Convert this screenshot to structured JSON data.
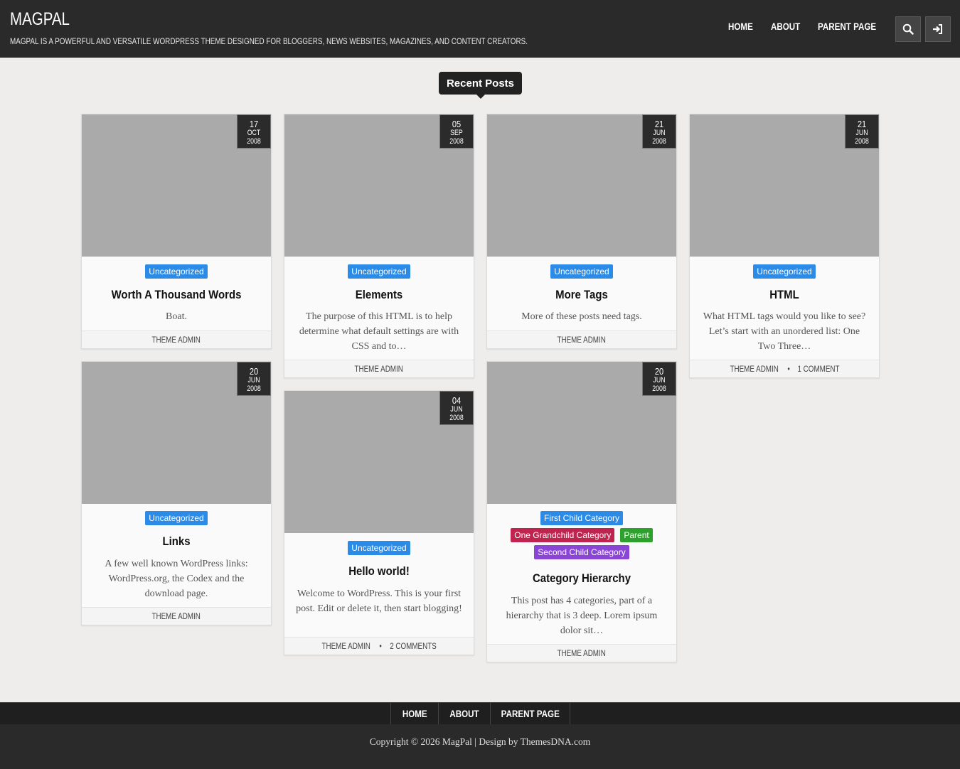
{
  "header": {
    "site_title": "MAGPAL",
    "site_description": "MAGPAL IS A POWERFUL AND VERSATILE WORDPRESS THEME DESIGNED FOR BLOGGERS, NEWS WEBSITES, MAGAZINES, AND CONTENT CREATORS.",
    "nav": [
      "HOME",
      "ABOUT",
      "PARENT PAGE"
    ]
  },
  "section_title": "Recent Posts",
  "colors": {
    "cat_blue": "#2c8be6",
    "cat_red": "#c0234e",
    "cat_green": "#2ca22c",
    "cat_purple": "#8a44d6"
  },
  "posts": [
    {
      "day": "17",
      "month": "OCT",
      "year": "2008",
      "cats": [
        {
          "name": "Uncategorized",
          "color": "#2c8be6"
        }
      ],
      "title": "Worth A Thousand Words",
      "excerpt": "Boat.",
      "author": "THEME ADMIN",
      "comments": ""
    },
    {
      "day": "05",
      "month": "SEP",
      "year": "2008",
      "cats": [
        {
          "name": "Uncategorized",
          "color": "#2c8be6"
        }
      ],
      "title": "Elements",
      "excerpt": "The purpose of this HTML is to help determine what default settings are with CSS and to…",
      "author": "THEME ADMIN",
      "comments": ""
    },
    {
      "day": "21",
      "month": "JUN",
      "year": "2008",
      "cats": [
        {
          "name": "Uncategorized",
          "color": "#2c8be6"
        }
      ],
      "title": "More Tags",
      "excerpt": "More of these posts need tags.",
      "author": "THEME ADMIN",
      "comments": ""
    },
    {
      "day": "21",
      "month": "JUN",
      "year": "2008",
      "cats": [
        {
          "name": "Uncategorized",
          "color": "#2c8be6"
        }
      ],
      "title": "HTML",
      "excerpt": "What HTML tags would you like to see? Let’s start with an unordered list: One Two Three…",
      "author": "THEME ADMIN",
      "comments": "1 COMMENT"
    },
    {
      "day": "20",
      "month": "JUN",
      "year": "2008",
      "cats": [
        {
          "name": "Uncategorized",
          "color": "#2c8be6"
        }
      ],
      "title": "Links",
      "excerpt": "A few well known WordPress links: WordPress.org, the Codex and the download page.",
      "author": "THEME ADMIN",
      "comments": ""
    },
    {
      "day": "04",
      "month": "JUN",
      "year": "2008",
      "cats": [
        {
          "name": "Uncategorized",
          "color": "#2c8be6"
        }
      ],
      "title": "Hello world!",
      "excerpt": "Welcome to WordPress. This is your first post. Edit or delete it, then start blogging!",
      "author": "THEME ADMIN",
      "comments": "2 COMMENTS"
    },
    {
      "day": "20",
      "month": "JUN",
      "year": "2008",
      "cats": [
        {
          "name": "First Child Category",
          "color": "#2c8be6"
        },
        {
          "name": "One Grandchild Category",
          "color": "#c0234e"
        },
        {
          "name": "Parent",
          "color": "#2ca22c"
        },
        {
          "name": "Second Child Category",
          "color": "#8a44d6"
        }
      ],
      "title": "Category Hierarchy",
      "excerpt": "This post has 4 categories, part of a hierarchy that is 3 deep. Lorem ipsum dolor sit…",
      "author": "THEME ADMIN",
      "comments": ""
    }
  ],
  "footer": {
    "nav": [
      "HOME",
      "ABOUT",
      "PARENT PAGE"
    ],
    "copyright": "Copyright © 2026 MagPal  |  Design by ThemesDNA.com"
  }
}
